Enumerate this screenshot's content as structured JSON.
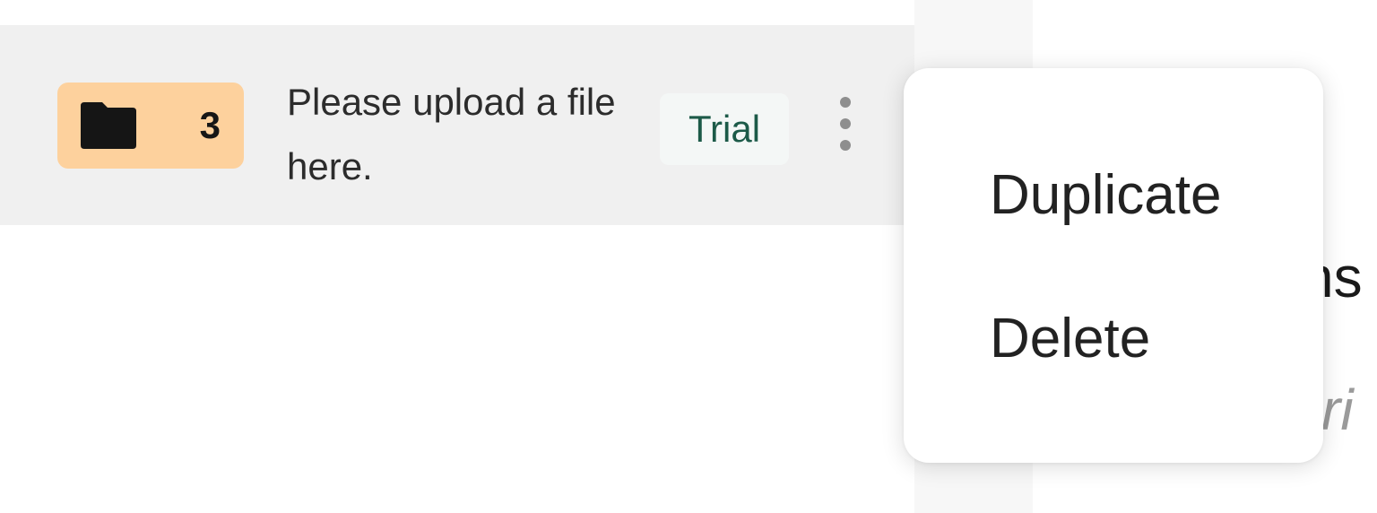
{
  "row": {
    "count": "3",
    "folder_icon": "folder-icon",
    "file_prompt": "Please upload a file here.",
    "tag": "Trial",
    "more_icon": "more-vertical-icon"
  },
  "menu": {
    "items": [
      {
        "label": "Duplicate"
      },
      {
        "label": "Delete"
      }
    ]
  },
  "right_pane": {
    "title_fragment": "ns",
    "description_fragment": "cri"
  },
  "colors": {
    "row_background": "#f0f0f0",
    "badge_background": "#fdd19d",
    "tag_background": "#f4f7f6",
    "tag_text": "#1c5a48",
    "divider": "#f7f7f7"
  }
}
